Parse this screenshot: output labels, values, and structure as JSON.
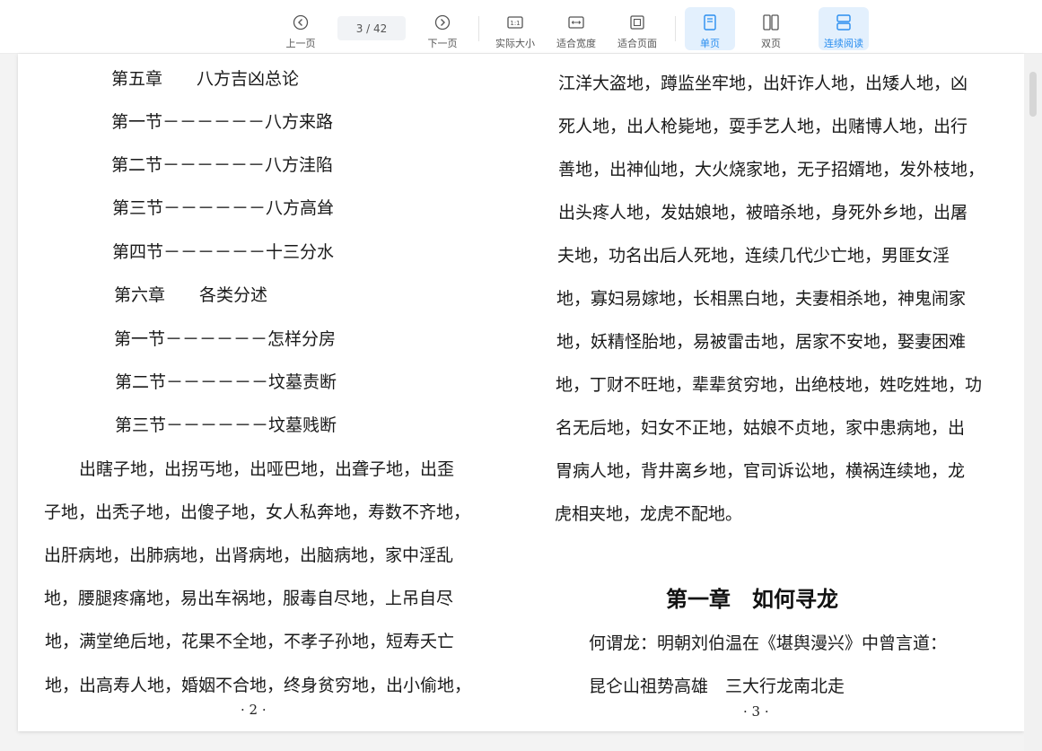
{
  "toolbar": {
    "prev_label": "上一页",
    "page_indicator": "3  / 42",
    "next_label": "下一页",
    "actual_size_label": "实际大小",
    "fit_width_label": "适合宽度",
    "fit_page_label": "适合页面",
    "single_page_label": "单页",
    "double_page_label": "双页",
    "continuous_label": "连续阅读",
    "accent_color": "#2a8ef0",
    "active_modes": [
      "单页",
      "连续阅读"
    ]
  },
  "left_page": {
    "toc": [
      {
        "label": "第五章　　八方吉凶总论"
      },
      {
        "label": "第一节－－－－－－八方来路"
      },
      {
        "label": "第二节－－－－－－八方洼陷"
      },
      {
        "label": "第三节－－－－－－八方高耸"
      },
      {
        "label": "第四节－－－－－－十三分水"
      },
      {
        "label": "第六章　　各类分述"
      },
      {
        "label": "第一节－－－－－－怎样分房"
      },
      {
        "label": "第二节－－－－－－坟墓责断"
      },
      {
        "label": "第三节－－－－－－坟墓贱断"
      }
    ],
    "body_lines": [
      "出瞎子地，出拐丐地，出哑巴地，出聋子地，出歪",
      "子地，出秃子地，出傻子地，女人私奔地，寿数不齐地，",
      "出肝病地，出肺病地，出肾病地，出脑病地，家中淫乱",
      "地，腰腿疼痛地，易出车祸地，服毒自尽地，上吊自尽",
      "地，满堂绝后地，花果不全地，不孝子孙地，短寿夭亡",
      "地，出高寿人地，婚姻不合地，终身贫穷地，出小偷地，"
    ],
    "page_number": "· 2 ·"
  },
  "right_page": {
    "body_lines": [
      "江洋大盗地，蹲监坐牢地，出奸诈人地，出矮人地，凶",
      "死人地，出人枪毙地，耍手艺人地，出赌博人地，出行",
      "善地，出神仙地，大火烧家地，无子招婿地，发外枝地，",
      "出头疼人地，发姑娘地，被暗杀地，身死外乡地，出屠",
      "夫地，功名出后人死地，连续几代少亡地，男匪女淫",
      "地，寡妇易嫁地，长相黑白地，夫妻相杀地，神鬼闹家",
      "地，妖精怪胎地，易被雷击地，居家不安地，娶妻困难",
      "地，丁财不旺地，辈辈贫穷地，出绝枝地，姓吃姓地，功",
      "名无后地，妇女不正地，姑娘不贞地，家中患病地，出",
      "胃病人地，背井离乡地，官司诉讼地，横祸连续地，龙",
      "虎相夹地，龙虎不配地。"
    ],
    "chapter_title": "第一章　如何寻龙",
    "intro_line": "何谓龙：明朝刘伯温在《堪舆漫兴》中曾言道：",
    "verse_line": "昆仑山祖势高雄　三大行龙南北走",
    "page_number": "· 3 ·"
  }
}
